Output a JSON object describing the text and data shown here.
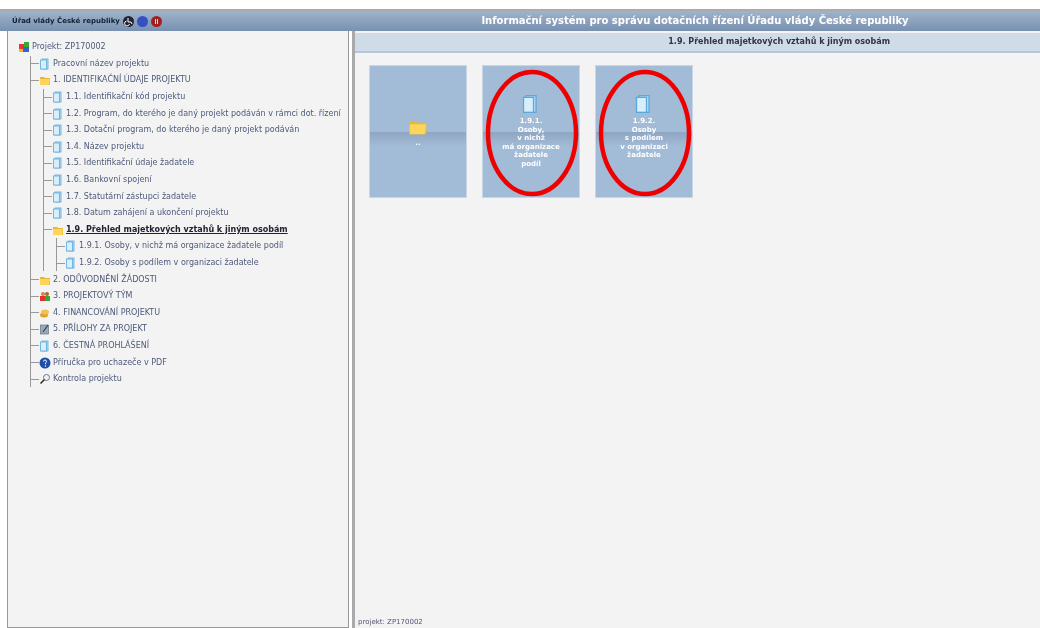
{
  "header": {
    "org": "Úřad vlády České republiky",
    "title": "Informační systém pro správu dotačních řízení Úřadu vlády České republiky"
  },
  "tree": {
    "label": "Projekt: ZP170002",
    "kind": "root",
    "children": [
      {
        "label": "Pracovní název projektu",
        "kind": "page",
        "selected": false
      },
      {
        "label": "1. IDENTIFIKAČNÍ ÚDAJE PROJEKTU",
        "kind": "folder",
        "selected": false,
        "children": [
          {
            "label": "1.1. Identifikační kód projektu",
            "kind": "page",
            "selected": false
          },
          {
            "label": "1.2. Program, do kterého je daný projekt podáván v rámci dot. řízení",
            "kind": "page",
            "selected": false
          },
          {
            "label": "1.3. Dotační program, do kterého je daný projekt podáván",
            "kind": "page",
            "selected": false
          },
          {
            "label": "1.4. Název projektu",
            "kind": "page",
            "selected": false
          },
          {
            "label": "1.5. Identifikační údaje žadatele",
            "kind": "page",
            "selected": false
          },
          {
            "label": "1.6. Bankovní spojení",
            "kind": "page",
            "selected": false
          },
          {
            "label": "1.7. Statutární zástupci žadatele",
            "kind": "page",
            "selected": false
          },
          {
            "label": "1.8. Datum zahájení a ukončení projektu",
            "kind": "page",
            "selected": false
          },
          {
            "label": "1.9. Přehled majetkových vztahů k jiným osobám",
            "kind": "folder",
            "selected": true,
            "children": [
              {
                "label": "1.9.1. Osoby, v nichž má organizace žadatele podíl",
                "kind": "page",
                "selected": false
              },
              {
                "label": "1.9.2. Osoby s podílem v organizaci žadatele",
                "kind": "page",
                "selected": false
              }
            ]
          }
        ]
      },
      {
        "label": "2. ODŮVODNĚNÍ ŽÁDOSTI",
        "kind": "folder",
        "selected": false
      },
      {
        "label": "3. PROJEKTOVÝ TÝM",
        "kind": "team",
        "selected": false
      },
      {
        "label": "4. FINANCOVÁNÍ PROJEKTU",
        "kind": "money",
        "selected": false
      },
      {
        "label": "5. PŘÍLOHY ZA PROJEKT",
        "kind": "attach",
        "selected": false
      },
      {
        "label": "6. ČESTNÁ PROHLÁŠENÍ",
        "kind": "page",
        "selected": false
      },
      {
        "label": "Příručka pro uchazeče v PDF",
        "kind": "help",
        "selected": false
      },
      {
        "label": "Kontrola projektu",
        "kind": "search",
        "selected": false
      }
    ]
  },
  "section_title": "1.9. Přehled majetkových vztahů k jiným osobám",
  "tiles": [
    {
      "kind": "folder",
      "lines": [
        ".."
      ],
      "highlighted": false
    },
    {
      "kind": "page",
      "lines": [
        "1.9.1.",
        "Osoby,",
        "v nichž",
        "má organizace",
        "žadatele",
        "podíl"
      ],
      "highlighted": true
    },
    {
      "kind": "page",
      "lines": [
        "1.9.2.",
        "Osoby",
        "s podílem",
        "v organizaci",
        "žadatele"
      ],
      "highlighted": true
    }
  ],
  "footer": "projekt: ZP170002"
}
